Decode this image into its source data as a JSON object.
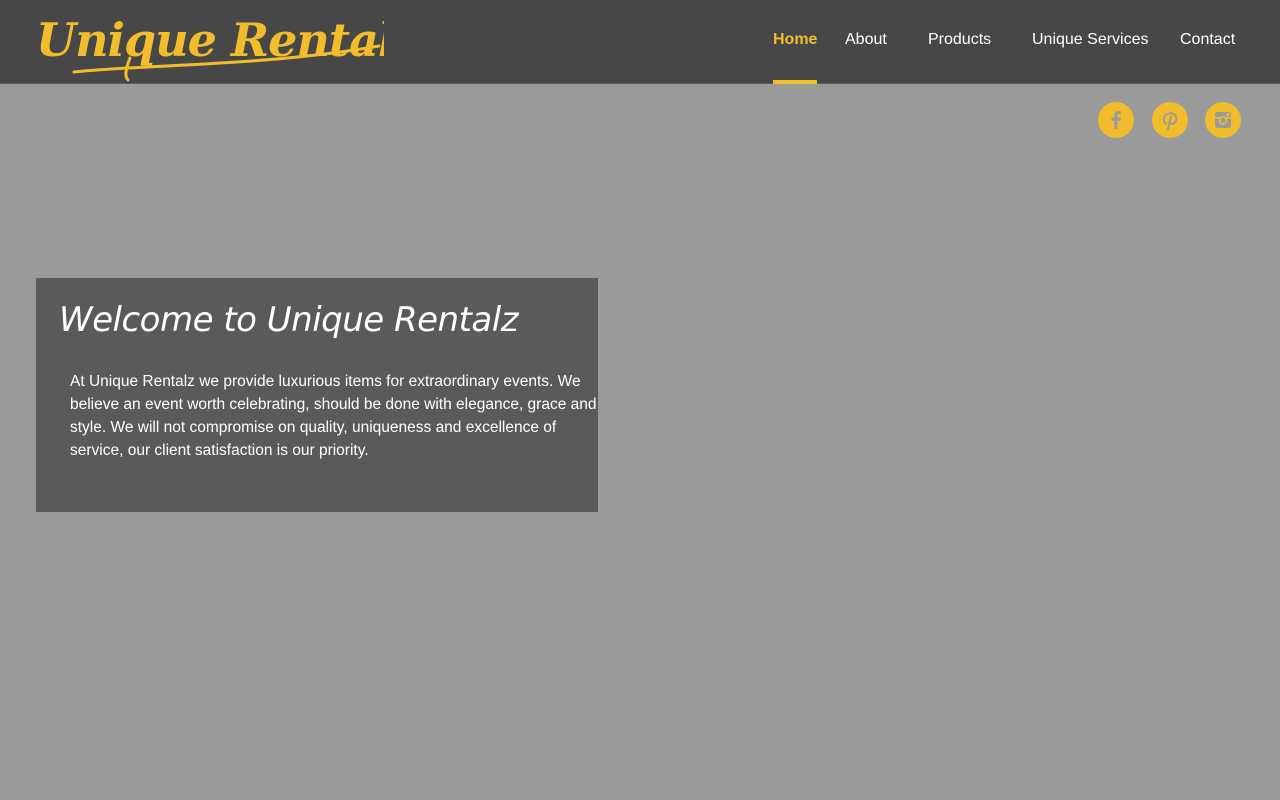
{
  "brand": {
    "logo_text": "Unique Rentalz",
    "accent_color": "#f2bd2c",
    "header_color": "#474747",
    "page_background": "#9a9a9a",
    "panel_color": "#5a5a5a"
  },
  "nav": {
    "items": [
      {
        "label": "Home",
        "active": true
      },
      {
        "label": "About",
        "active": false
      },
      {
        "label": "Products",
        "active": false
      },
      {
        "label": "Unique Services",
        "active": false
      },
      {
        "label": "Contact",
        "active": false
      }
    ]
  },
  "social": {
    "links": [
      {
        "name": "facebook-icon"
      },
      {
        "name": "pinterest-icon"
      },
      {
        "name": "instagram-icon"
      }
    ]
  },
  "hero": {
    "title": "Welcome to Unique Rentalz",
    "body": "At Unique Rentalz we provide luxurious items for extraordinary events. We believe an event worth celebrating, should be done with elegance, grace and style. We will not compromise on quality, uniqueness and excellence of service, our client satisfaction is our priority."
  }
}
